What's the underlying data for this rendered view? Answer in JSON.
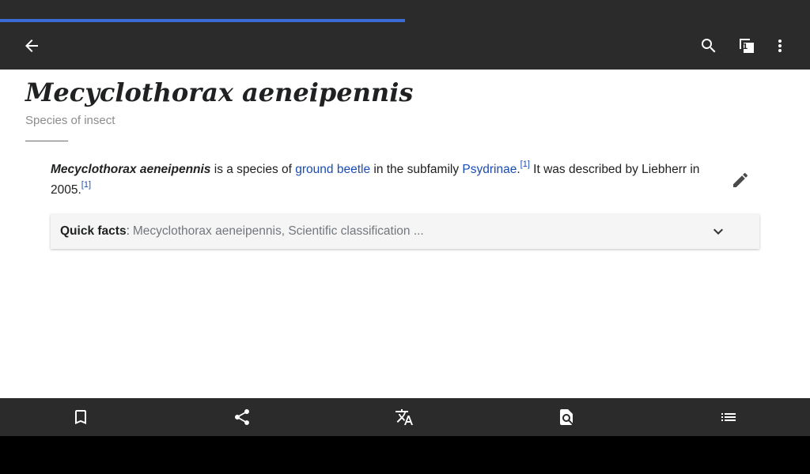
{
  "app": {
    "load_progress_percent": 50,
    "tab_count": "1"
  },
  "article": {
    "title": "Mecyclothorax aeneipennis",
    "subtitle": "Species of insect",
    "lead": {
      "subject": "Mecyclothorax aeneipennis",
      "text1": " is a species of ",
      "link1": "ground beetle",
      "text2": " in the subfamily ",
      "link2": "Psydrinae",
      "text3": ".",
      "ref1": "[1]",
      "text4": " It was described by Liebherr in 2005.",
      "ref2": "[1]"
    },
    "quick_facts": {
      "label": "Quick facts",
      "separator": ":",
      "summary": "Mecyclothorax aeneipennis, Scientific classification ..."
    }
  },
  "icons": {
    "back": "arrow-left-icon",
    "search": "search-icon",
    "tabs": "tabs-icon",
    "more": "more-vert-icon",
    "edit": "pencil-icon",
    "expand": "chevron-down-icon",
    "bookmark": "bookmark-icon",
    "share": "share-icon",
    "translate": "translate-icon",
    "find": "find-in-page-icon",
    "contents": "table-of-contents-icon"
  },
  "colors": {
    "toolbar": "#2b2b2b",
    "progress": "#3a6bd6",
    "link": "#1a4cb4"
  }
}
